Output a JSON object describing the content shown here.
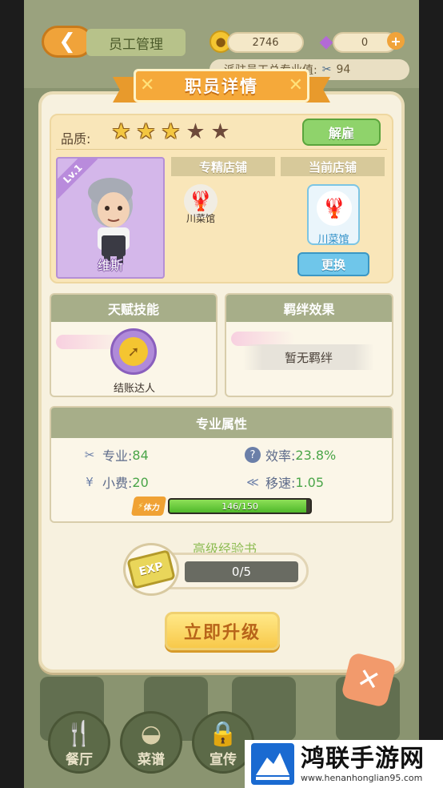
{
  "header": {
    "title": "员工管理",
    "coins": "2746",
    "gems": "0",
    "total_skill_label": "派驻员工总专业值:",
    "total_skill_value": "94"
  },
  "dialog": {
    "title": "职员详情",
    "quality_label": "品质:",
    "stars_filled": 3,
    "stars_total": 5,
    "fire_button": "解雇",
    "character": {
      "level": "Lv.1",
      "name": "维斯"
    },
    "specialty_store_header": "专精店铺",
    "specialty_store_name": "川菜馆",
    "current_store_header": "当前店铺",
    "current_store_name": "川菜馆",
    "change_button": "更换",
    "talent_header": "天赋技能",
    "talent_name": "结账达人",
    "bond_header": "羁绊效果",
    "bond_empty": "暂无羁绊",
    "attributes_header": "专业属性",
    "stats": {
      "skill_label": "专业:",
      "skill_value": "84",
      "efficiency_label": "效率:",
      "efficiency_value": "23.8%",
      "tip_label": "小费:",
      "tip_value": "20",
      "speed_label": "移速:",
      "speed_value": "1.05"
    },
    "stamina": {
      "label": "体力",
      "text": "146/150",
      "fraction": 0.973
    },
    "exp_book": {
      "title": "高级经验书",
      "icon_text": "EXP",
      "count": "0/5"
    },
    "upgrade_button": "立即升级"
  },
  "bottom_nav": [
    {
      "label": "餐厅",
      "icon": "utensils-icon"
    },
    {
      "label": "菜谱",
      "icon": "bowl-icon"
    },
    {
      "label": "宣传",
      "icon": "lock-icon"
    }
  ],
  "watermark": {
    "name": "鸿联手游网",
    "url": "www.henanhonglian95.com"
  },
  "colors": {
    "accent_orange": "#f5a93a",
    "green_value": "#4aa548",
    "panel_header": "#a7ae89",
    "portrait_purple": "#d4b7ea"
  }
}
